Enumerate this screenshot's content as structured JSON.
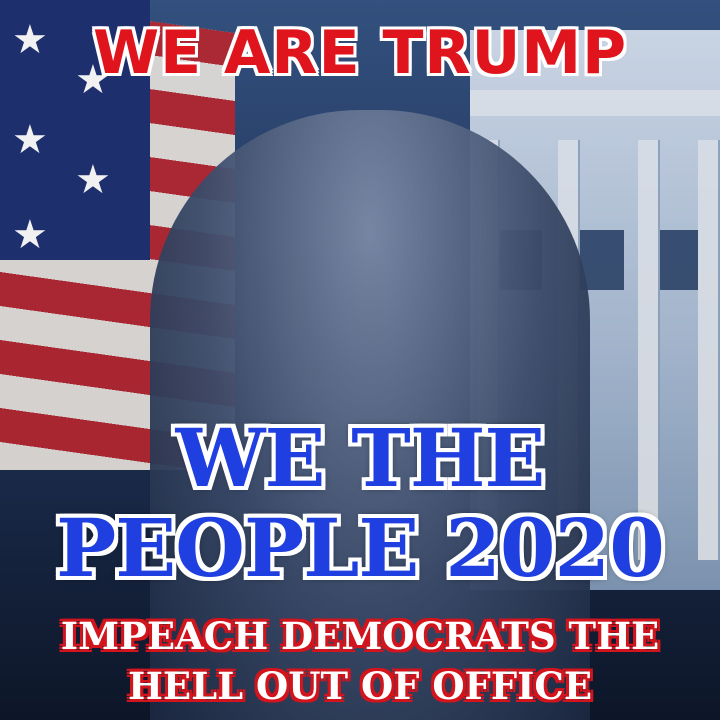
{
  "headline_top": "WE ARE TRUMP",
  "headline_middle_line1": "WE THE",
  "headline_middle_line2": "PEOPLE 2020",
  "headline_bottom_line1": "IMPEACH DEMOCRATS THE",
  "headline_bottom_line2": "HELL OUT OF OFFICE",
  "colors": {
    "headline_top": "#e0141c",
    "headline_middle": "#1f3fe0",
    "headline_bottom_text": "#ffffff",
    "headline_bottom_outline": "#d2141c"
  },
  "icons": [
    "star-icon"
  ]
}
